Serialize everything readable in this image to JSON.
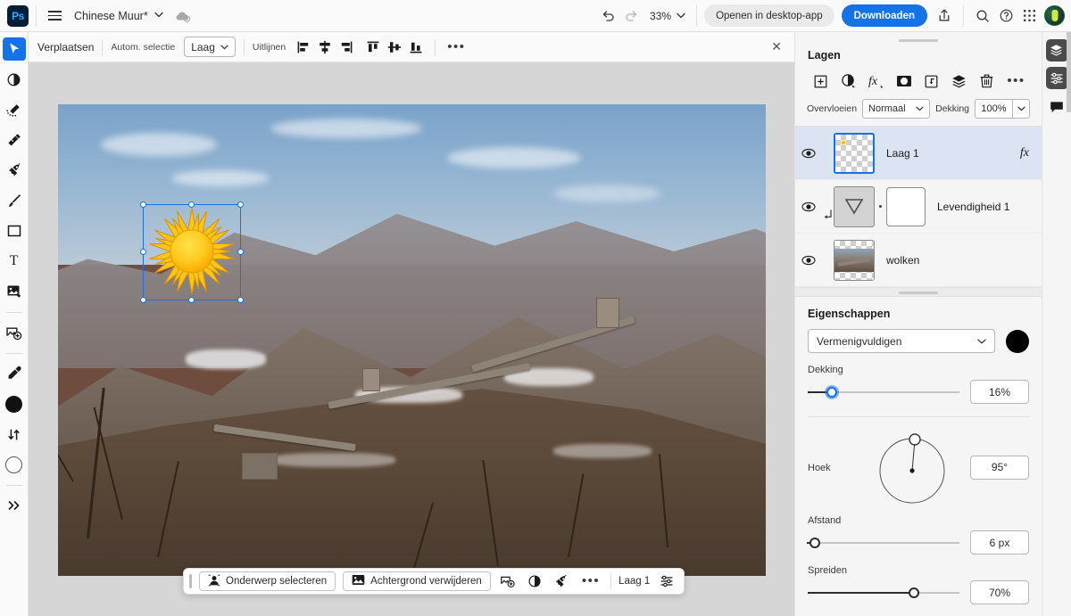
{
  "app": {
    "name": "Photoshop Web",
    "logo_text": "Ps"
  },
  "topbar": {
    "menu_icon": "hamburger-icon",
    "document_title": "Chinese Muur*",
    "title_chevron": "chevron-down-icon",
    "cloud_status_icon": "cloud-sync-icon",
    "undo_icon": "undo-icon",
    "redo_icon": "redo-icon",
    "zoom_level": "33%",
    "zoom_chevron": "chevron-down-icon",
    "open_desktop_label": "Openen in desktop-app",
    "download_label": "Downloaden",
    "share_icon": "share-icon",
    "search_icon": "search-icon",
    "help_icon": "help-icon",
    "apps_icon": "app-grid-icon",
    "avatar_label": "avatar"
  },
  "toolbar": {
    "tools": [
      {
        "name": "move-tool",
        "icon": "cursor-arrow-icon",
        "active": true
      },
      {
        "name": "adjustment-tool",
        "icon": "half-circle-icon",
        "active": false
      },
      {
        "name": "quick-select-tool",
        "icon": "magic-wand-icon",
        "active": false
      },
      {
        "name": "spot-heal-tool",
        "icon": "healing-brush-icon",
        "active": false
      },
      {
        "name": "remove-tool",
        "icon": "rocket-eraser-icon",
        "active": false
      },
      {
        "name": "brush-tool",
        "icon": "paint-brush-icon",
        "active": false
      },
      {
        "name": "shape-tool",
        "icon": "rectangle-icon",
        "active": false
      },
      {
        "name": "type-tool",
        "icon": "text-t-icon",
        "active": false
      },
      {
        "name": "gradient-tool",
        "icon": "image-fill-icon",
        "active": false
      },
      {
        "name": "generative-fill-tool",
        "icon": "generative-expand-icon",
        "active": false
      },
      {
        "name": "eyedropper-tool",
        "icon": "eyedropper-icon",
        "active": false
      }
    ],
    "foreground_color": "#111111",
    "background_color": "#ffffff",
    "swap_colors_icon": "swap-arrows-icon",
    "more_tools_icon": "double-chevron-right-icon"
  },
  "options_bar": {
    "tool_name": "Verplaatsen",
    "auto_select_label": "Autom. selectie",
    "auto_select_value": "Laag",
    "align_label": "Uitlijnen",
    "align_buttons": [
      {
        "name": "align-left-edges",
        "icon": "align-left-icon"
      },
      {
        "name": "align-horizontal-centers",
        "icon": "align-center-horizontal-icon"
      },
      {
        "name": "align-right-edges",
        "icon": "align-right-icon"
      },
      {
        "name": "align-top-edges",
        "icon": "align-top-icon"
      },
      {
        "name": "align-vertical-centers",
        "icon": "align-center-vertical-icon"
      },
      {
        "name": "align-bottom-edges",
        "icon": "align-bottom-icon"
      }
    ],
    "more_label": "•••",
    "close_label": "✕"
  },
  "canvas": {
    "zoom": "33%",
    "selection": {
      "layer": "Laag 1",
      "handles": 8
    }
  },
  "contextual_toolbar": {
    "select_subject_label": "Onderwerp selecteren",
    "select_subject_icon": "subject-person-icon",
    "remove_background_label": "Achtergrond verwijderen",
    "remove_background_icon": "image-icon",
    "generative_expand_icon": "generative-expand-icon",
    "adjustment_icon": "half-circle-icon",
    "remove_tool_icon": "rocket-eraser-icon",
    "more_icon": "more-dots-icon",
    "active_layer_label": "Laag 1",
    "settings_icon": "sliders-icon"
  },
  "layers_panel": {
    "title": "Lagen",
    "tools": [
      {
        "name": "add-layer-button",
        "icon": "plus-square-icon"
      },
      {
        "name": "add-adjustment-layer-button",
        "icon": "half-circle-icon"
      },
      {
        "name": "layer-effects-button",
        "icon": "fx-icon"
      },
      {
        "name": "add-mask-button",
        "icon": "mask-icon"
      },
      {
        "name": "clipping-mask-button",
        "icon": "clipping-mask-icon"
      },
      {
        "name": "group-layers-button",
        "icon": "stack-icon"
      },
      {
        "name": "delete-layer-button",
        "icon": "trash-icon"
      },
      {
        "name": "layers-more-button",
        "icon": "more-dots-icon"
      }
    ],
    "blend_label": "Overvloeien",
    "blend_value": "Normaal",
    "opacity_label": "Dekking",
    "opacity_value": "100%",
    "layers": [
      {
        "name": "Laag 1",
        "visible": true,
        "selected": true,
        "thumb_type": "transparent",
        "has_fx": true,
        "fx_label": "fx",
        "clipped": false,
        "has_mask": false
      },
      {
        "name": "Levendigheid 1",
        "visible": true,
        "selected": false,
        "thumb_type": "adjustment",
        "has_fx": false,
        "clipped": true,
        "has_mask": true
      },
      {
        "name": "wolken",
        "visible": true,
        "selected": false,
        "thumb_type": "photo",
        "has_fx": false,
        "clipped": false,
        "has_mask": false
      }
    ]
  },
  "properties_panel": {
    "title": "Eigenschappen",
    "blend_mode": "Vermenigvuldigen",
    "color": "#000000",
    "opacity_label": "Dekking",
    "opacity_value": "16%",
    "opacity_percent": 16,
    "angle_label": "Hoek",
    "angle_value": "95°",
    "angle_degrees": 95,
    "distance_label": "Afstand",
    "distance_value": "6 px",
    "distance_percent": 3,
    "spread_label": "Spreiden",
    "spread_value": "70%"
  },
  "edge_bar": {
    "buttons": [
      {
        "name": "layers-panel-toggle",
        "icon": "stack-icon",
        "active": true
      },
      {
        "name": "properties-panel-toggle",
        "icon": "sliders-icon",
        "active": true
      },
      {
        "name": "comments-panel-toggle",
        "icon": "comment-icon",
        "active": false
      }
    ]
  },
  "colors": {
    "accent": "#1473e6",
    "ps_navy": "#001e36",
    "ps_blue": "#31a8ff",
    "panel_bg": "#f5f5f5",
    "canvas_bg": "#d6d6d6",
    "selected_layer_bg": "#dce4f4"
  }
}
